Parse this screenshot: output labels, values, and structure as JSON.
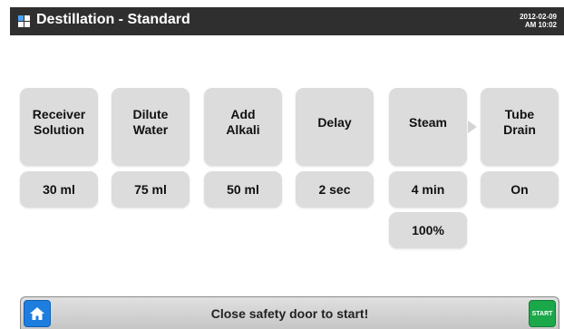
{
  "header": {
    "title": "Destillation - Standard",
    "date": "2012-02-09",
    "time": "AM 10:02",
    "icon": "grid-icon"
  },
  "steps": [
    {
      "label_line1": "Receiver",
      "label_line2": "Solution",
      "value": "30 ml"
    },
    {
      "label_line1": "Dilute",
      "label_line2": "Water",
      "value": "75 ml"
    },
    {
      "label_line1": "Add",
      "label_line2": "Alkali",
      "value": "50 ml"
    },
    {
      "label_line1": "Delay",
      "label_line2": "",
      "value": "2 sec"
    },
    {
      "label_line1": "Steam",
      "label_line2": "",
      "value": "4 min",
      "extra_value": "100%"
    },
    {
      "label_line1": "Tube",
      "label_line2": "Drain",
      "value": "On"
    }
  ],
  "footer": {
    "status": "Close safety door to start!",
    "start_label": "START",
    "home_icon": "home-icon"
  },
  "colors": {
    "titlebar": "#2f2f2f",
    "tile": "#dcdcdc",
    "home": "#1e7ee0",
    "start": "#1aa84a"
  }
}
